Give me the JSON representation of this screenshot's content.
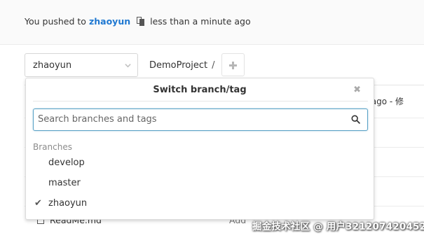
{
  "push_notice": {
    "prefix": "You pushed to",
    "branch": "zhaoyun",
    "time": "less than a minute ago"
  },
  "toolbar": {
    "branch_selector_value": "zhaoyun",
    "project_name": "DemoProject",
    "separator": "/"
  },
  "background": {
    "commit_snippet": "utes ago - 修",
    "file_name": "ReadMe.md",
    "file_action": "Add "
  },
  "dropdown": {
    "title": "Switch branch/tag",
    "close_glyph": "✖",
    "search_placeholder": "Search branches and tags",
    "section_label": "Branches",
    "branches": [
      {
        "name": "develop",
        "selected": false
      },
      {
        "name": "master",
        "selected": false
      },
      {
        "name": "zhaoyun",
        "selected": true
      }
    ]
  },
  "watermark": "掘金技术社区 @ 用户321207420452",
  "colors": {
    "link": "#1f78d1",
    "search_focus_border": "#5aa2c6"
  }
}
